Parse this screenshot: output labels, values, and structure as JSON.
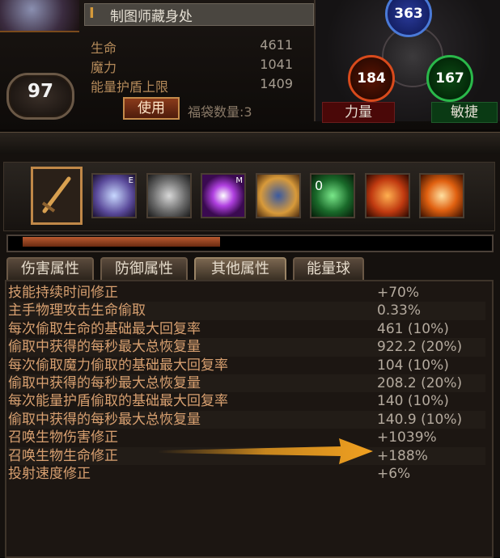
{
  "header": {
    "title": "制图师藏身处",
    "level": "97",
    "stats": [
      {
        "label": "生命",
        "value": "4611"
      },
      {
        "label": "魔力",
        "value": "1041"
      },
      {
        "label": "能量护盾上限",
        "value": "1409"
      }
    ],
    "use_button": "使用",
    "bag_count": "福袋数量:3"
  },
  "orbs": {
    "intelligence": "363",
    "strength": "184",
    "dexterity": "167",
    "strength_label": "力量",
    "dexterity_label": "敏捷"
  },
  "progress": {
    "experience_fraction": 0.41
  },
  "tabs": [
    "伤害属性",
    "防御属性",
    "其他属性",
    "能量球"
  ],
  "active_tab": "其他属性",
  "attributes": [
    {
      "label": "技能持续时间修正",
      "value": "+70%"
    },
    {
      "label": "主手物理攻击生命偷取",
      "value": "0.33%"
    },
    {
      "label": "每次偷取生命的基础最大回复率",
      "value": "461 (10%)"
    },
    {
      "label": "偷取中获得的每秒最大总恢复量",
      "value": "922.2 (20%)"
    },
    {
      "label": "每次偷取魔力偷取的基础最大回复率",
      "value": "104 (10%)"
    },
    {
      "label": "偷取中获得的每秒最大总恢复量",
      "value": "208.2 (20%)"
    },
    {
      "label": "每次能量护盾偷取的基础最大回复率",
      "value": "140 (10%)"
    },
    {
      "label": "偷取中获得的每秒最大总恢复量",
      "value": "140.9 (10%)"
    },
    {
      "label": "召唤生物伤害修正",
      "value": "+1039%"
    },
    {
      "label": "召唤生物生命修正",
      "value": "+188%"
    },
    {
      "label": "投射速度修正",
      "value": "+6%"
    }
  ],
  "skill_icons": [
    "sword-icon",
    "skeleton-mage-icon",
    "zombie-icon",
    "eye-icon",
    "fist-icon",
    "spectre-icon",
    "fire-golem-icon",
    "flame-spirit-icon"
  ],
  "skill_badges": {
    "skill_2": "E",
    "skill_4": "M",
    "skill_6": "0"
  },
  "colors": {
    "accent": "#c08848",
    "label": "#d8a070",
    "value": "#b4aa9e",
    "arrow": "#f0a020"
  }
}
